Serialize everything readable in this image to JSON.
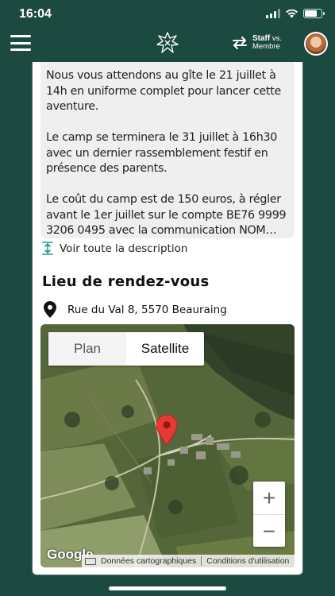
{
  "status_bar": {
    "time": "16:04"
  },
  "header": {
    "switch_label_top": "Staff",
    "switch_label_vs": "vs.",
    "switch_label_bottom": "Membre"
  },
  "description": {
    "paragraphs": [
      "Nous vous attendons au gîte le 21 juillet à 14h en uniforme complet pour lancer cette aventure.",
      "Le camp se terminera le 31 juillet à 16h30 avec un dernier rassemblement festif en présence des parents.",
      "Le coût du camp est de 150 euros, à régler avant le 1er juillet sur le compte BE76 9999 3206 0495 avec la communication NOM…"
    ],
    "see_all_label": "Voir toute la description"
  },
  "meeting_point": {
    "title": "Lieu de rendez-vous",
    "address": "Rue du Val 8, 5570 Beauraing"
  },
  "map": {
    "tabs": [
      "Plan",
      "Satellite"
    ],
    "selected_tab": "Satellite",
    "zoom_in": "+",
    "zoom_out": "−",
    "google_logo": "Google",
    "attribution_data": "Données cartographiques",
    "attribution_terms": "Conditions d'utilisation"
  },
  "colors": {
    "brand": "#1d4a40",
    "marker": "#e53935"
  }
}
